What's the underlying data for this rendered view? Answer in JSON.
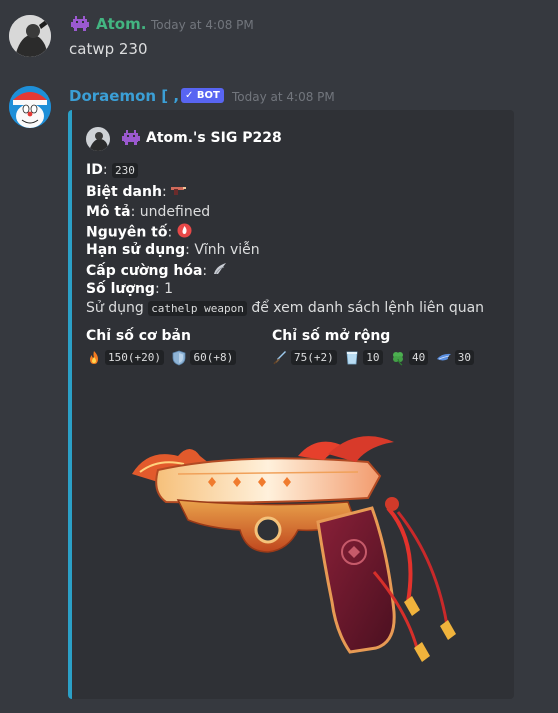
{
  "messages": [
    {
      "author": "Atom.",
      "author_color": "#43b581",
      "timestamp": "Today at 4:08 PM",
      "text": "catwp 230"
    },
    {
      "author": "Doraemon [ , ]",
      "author_color": "#3b9fd6",
      "bot_badge": "✓ BOT",
      "timestamp": "Today at 4:08 PM"
    }
  ],
  "embed": {
    "accent_color": "#2ba0c7",
    "author_name": "Atom.'s SIG P228",
    "fields": {
      "id_label": "ID",
      "id_value": "230",
      "nickname_label": "Biệt danh",
      "description_label": "Mô tả",
      "description_value": "undefined",
      "element_label": "Nguyên tố",
      "expiry_label": "Hạn sử dụng",
      "expiry_value": "Vĩnh viễn",
      "enhance_label": "Cấp cường hóa",
      "quantity_label": "Số lượng",
      "quantity_value": "1",
      "usage_prefix": "Sử dụng",
      "usage_command": "cathelp weapon",
      "usage_suffix": "để xem danh sách lệnh liên quan"
    },
    "basic_stats": {
      "title": "Chỉ số cơ bản",
      "items": [
        {
          "icon": "fire-icon",
          "value": "150(+20)"
        },
        {
          "icon": "shield-icon",
          "value": "60(+8)"
        }
      ]
    },
    "extended_stats": {
      "title": "Chỉ số mở rộng",
      "items": [
        {
          "icon": "sword-icon",
          "value": "75(+2)"
        },
        {
          "icon": "cup-icon",
          "value": "10"
        },
        {
          "icon": "clover-icon",
          "value": "40"
        },
        {
          "icon": "wing-icon",
          "value": "30"
        }
      ]
    },
    "image": "pistol-image"
  }
}
